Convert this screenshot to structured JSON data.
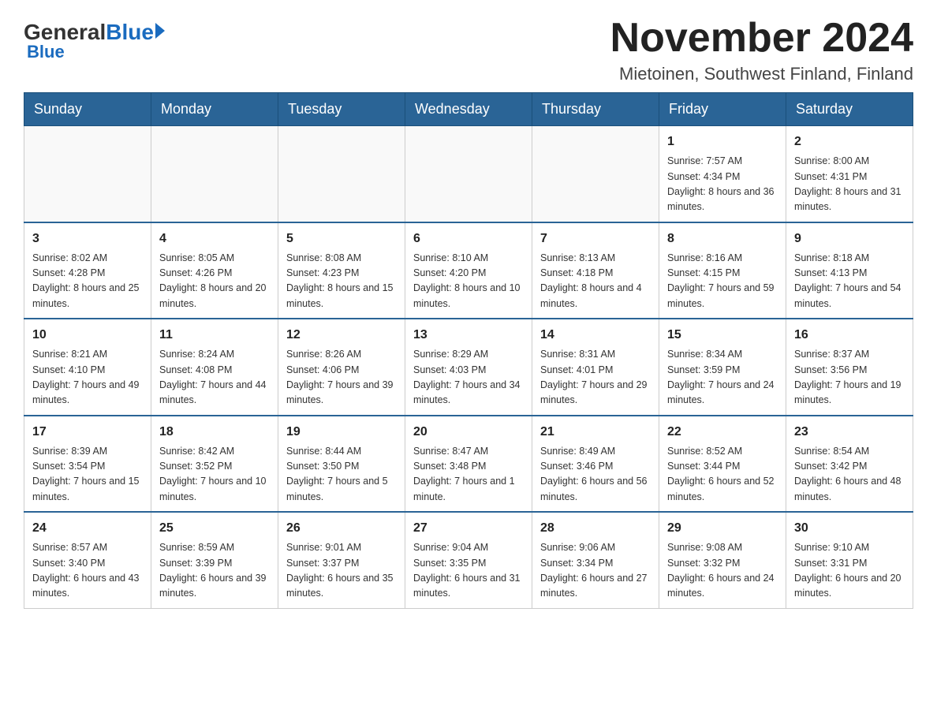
{
  "header": {
    "logo_general": "General",
    "logo_blue": "Blue",
    "month_title": "November 2024",
    "location": "Mietoinen, Southwest Finland, Finland"
  },
  "days_of_week": [
    "Sunday",
    "Monday",
    "Tuesday",
    "Wednesday",
    "Thursday",
    "Friday",
    "Saturday"
  ],
  "weeks": [
    [
      {
        "day": "",
        "info": ""
      },
      {
        "day": "",
        "info": ""
      },
      {
        "day": "",
        "info": ""
      },
      {
        "day": "",
        "info": ""
      },
      {
        "day": "",
        "info": ""
      },
      {
        "day": "1",
        "info": "Sunrise: 7:57 AM\nSunset: 4:34 PM\nDaylight: 8 hours\nand 36 minutes."
      },
      {
        "day": "2",
        "info": "Sunrise: 8:00 AM\nSunset: 4:31 PM\nDaylight: 8 hours\nand 31 minutes."
      }
    ],
    [
      {
        "day": "3",
        "info": "Sunrise: 8:02 AM\nSunset: 4:28 PM\nDaylight: 8 hours\nand 25 minutes."
      },
      {
        "day": "4",
        "info": "Sunrise: 8:05 AM\nSunset: 4:26 PM\nDaylight: 8 hours\nand 20 minutes."
      },
      {
        "day": "5",
        "info": "Sunrise: 8:08 AM\nSunset: 4:23 PM\nDaylight: 8 hours\nand 15 minutes."
      },
      {
        "day": "6",
        "info": "Sunrise: 8:10 AM\nSunset: 4:20 PM\nDaylight: 8 hours\nand 10 minutes."
      },
      {
        "day": "7",
        "info": "Sunrise: 8:13 AM\nSunset: 4:18 PM\nDaylight: 8 hours\nand 4 minutes."
      },
      {
        "day": "8",
        "info": "Sunrise: 8:16 AM\nSunset: 4:15 PM\nDaylight: 7 hours\nand 59 minutes."
      },
      {
        "day": "9",
        "info": "Sunrise: 8:18 AM\nSunset: 4:13 PM\nDaylight: 7 hours\nand 54 minutes."
      }
    ],
    [
      {
        "day": "10",
        "info": "Sunrise: 8:21 AM\nSunset: 4:10 PM\nDaylight: 7 hours\nand 49 minutes."
      },
      {
        "day": "11",
        "info": "Sunrise: 8:24 AM\nSunset: 4:08 PM\nDaylight: 7 hours\nand 44 minutes."
      },
      {
        "day": "12",
        "info": "Sunrise: 8:26 AM\nSunset: 4:06 PM\nDaylight: 7 hours\nand 39 minutes."
      },
      {
        "day": "13",
        "info": "Sunrise: 8:29 AM\nSunset: 4:03 PM\nDaylight: 7 hours\nand 34 minutes."
      },
      {
        "day": "14",
        "info": "Sunrise: 8:31 AM\nSunset: 4:01 PM\nDaylight: 7 hours\nand 29 minutes."
      },
      {
        "day": "15",
        "info": "Sunrise: 8:34 AM\nSunset: 3:59 PM\nDaylight: 7 hours\nand 24 minutes."
      },
      {
        "day": "16",
        "info": "Sunrise: 8:37 AM\nSunset: 3:56 PM\nDaylight: 7 hours\nand 19 minutes."
      }
    ],
    [
      {
        "day": "17",
        "info": "Sunrise: 8:39 AM\nSunset: 3:54 PM\nDaylight: 7 hours\nand 15 minutes."
      },
      {
        "day": "18",
        "info": "Sunrise: 8:42 AM\nSunset: 3:52 PM\nDaylight: 7 hours\nand 10 minutes."
      },
      {
        "day": "19",
        "info": "Sunrise: 8:44 AM\nSunset: 3:50 PM\nDaylight: 7 hours\nand 5 minutes."
      },
      {
        "day": "20",
        "info": "Sunrise: 8:47 AM\nSunset: 3:48 PM\nDaylight: 7 hours\nand 1 minute."
      },
      {
        "day": "21",
        "info": "Sunrise: 8:49 AM\nSunset: 3:46 PM\nDaylight: 6 hours\nand 56 minutes."
      },
      {
        "day": "22",
        "info": "Sunrise: 8:52 AM\nSunset: 3:44 PM\nDaylight: 6 hours\nand 52 minutes."
      },
      {
        "day": "23",
        "info": "Sunrise: 8:54 AM\nSunset: 3:42 PM\nDaylight: 6 hours\nand 48 minutes."
      }
    ],
    [
      {
        "day": "24",
        "info": "Sunrise: 8:57 AM\nSunset: 3:40 PM\nDaylight: 6 hours\nand 43 minutes."
      },
      {
        "day": "25",
        "info": "Sunrise: 8:59 AM\nSunset: 3:39 PM\nDaylight: 6 hours\nand 39 minutes."
      },
      {
        "day": "26",
        "info": "Sunrise: 9:01 AM\nSunset: 3:37 PM\nDaylight: 6 hours\nand 35 minutes."
      },
      {
        "day": "27",
        "info": "Sunrise: 9:04 AM\nSunset: 3:35 PM\nDaylight: 6 hours\nand 31 minutes."
      },
      {
        "day": "28",
        "info": "Sunrise: 9:06 AM\nSunset: 3:34 PM\nDaylight: 6 hours\nand 27 minutes."
      },
      {
        "day": "29",
        "info": "Sunrise: 9:08 AM\nSunset: 3:32 PM\nDaylight: 6 hours\nand 24 minutes."
      },
      {
        "day": "30",
        "info": "Sunrise: 9:10 AM\nSunset: 3:31 PM\nDaylight: 6 hours\nand 20 minutes."
      }
    ]
  ]
}
